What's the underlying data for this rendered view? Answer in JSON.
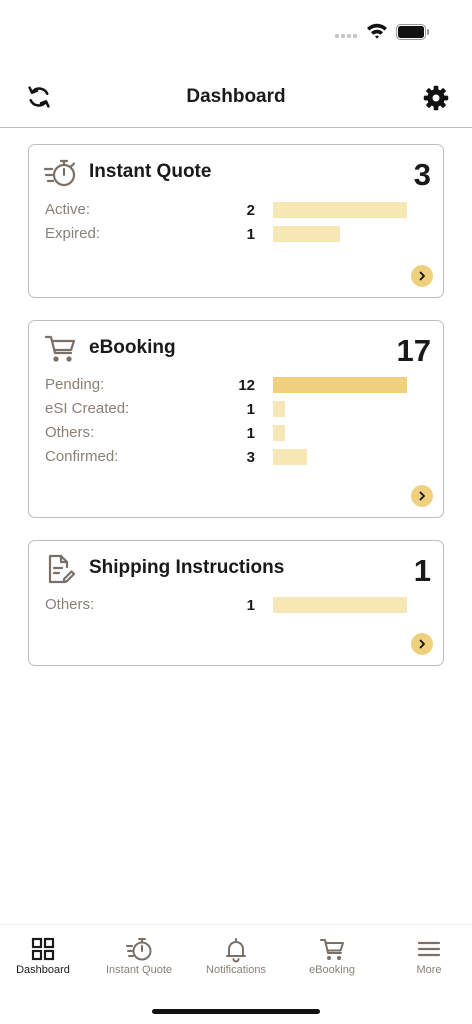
{
  "header": {
    "title": "Dashboard"
  },
  "cards": {
    "instant_quote": {
      "title": "Instant Quote",
      "total": "3",
      "rows": [
        {
          "label": "Active:",
          "count": "2",
          "fraction": 1.0
        },
        {
          "label": "Expired:",
          "count": "1",
          "fraction": 0.5
        }
      ]
    },
    "ebooking": {
      "title": "eBooking",
      "total": "17",
      "rows": [
        {
          "label": "Pending:",
          "count": "12",
          "fraction": 1.0
        },
        {
          "label": "eSI Created:",
          "count": "1",
          "fraction": 0.083
        },
        {
          "label": "Others:",
          "count": "1",
          "fraction": 0.083
        },
        {
          "label": "Confirmed:",
          "count": "3",
          "fraction": 0.25
        }
      ]
    },
    "shipping_instructions": {
      "title": "Shipping Instructions",
      "total": "1",
      "rows": [
        {
          "label": "Others:",
          "count": "1",
          "fraction": 1.0
        }
      ]
    }
  },
  "tabs": [
    {
      "label": "Dashboard",
      "icon": "grid-icon",
      "active": true
    },
    {
      "label": "Instant Quote",
      "icon": "stopwatch-icon",
      "active": false
    },
    {
      "label": "Notifications",
      "icon": "bell-icon",
      "active": false
    },
    {
      "label": "eBooking",
      "icon": "cart-icon",
      "active": false
    },
    {
      "label": "More",
      "icon": "menu-icon",
      "active": false
    }
  ],
  "colors": {
    "accent": "#f0d07f",
    "accent_light": "#f7e7b5",
    "label": "#8a8177",
    "icon": "#7a7068"
  }
}
